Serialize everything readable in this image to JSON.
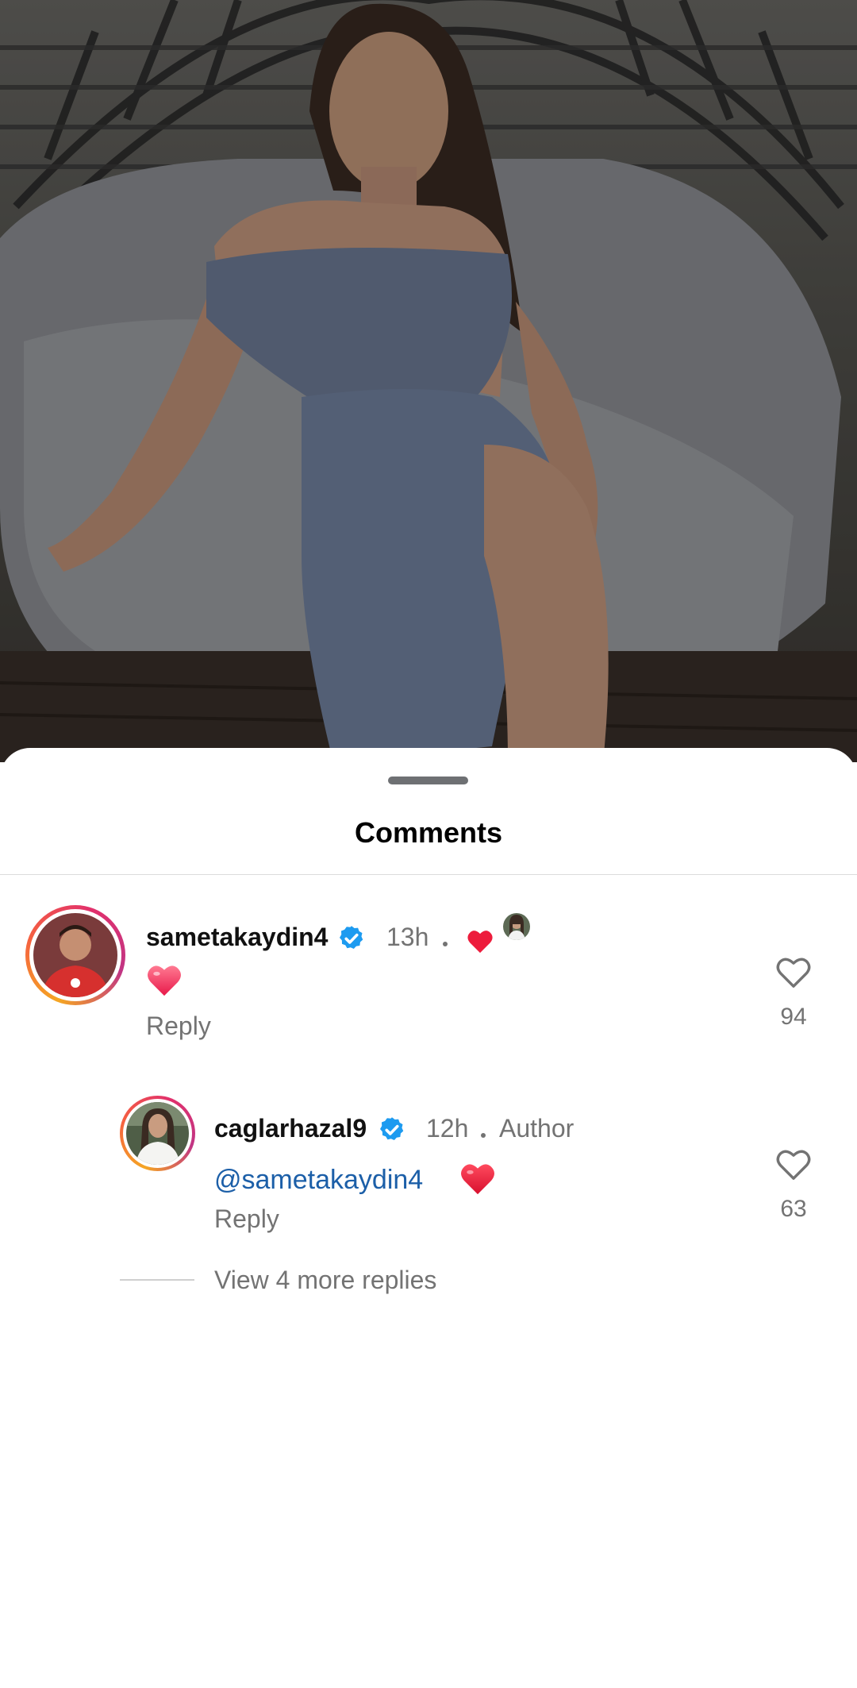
{
  "sheet": {
    "title": "Comments"
  },
  "comments": [
    {
      "username": "sametakaydin4",
      "verified": true,
      "time": "13h",
      "liked_by_author": true,
      "body_emoji": "heart",
      "reply_label": "Reply",
      "likes": "94"
    }
  ],
  "reply": {
    "username": "caglarhazal9",
    "verified": true,
    "time": "12h",
    "badge": "Author",
    "mention": "@sametakaydin4",
    "body_emoji": "heart",
    "reply_label": "Reply",
    "likes": "63"
  },
  "view_more": "View 4 more replies",
  "colors": {
    "verified_blue": "#1d9bf0",
    "heart_red": "#ed1c3c",
    "mention_blue": "#1c5fa8",
    "muted_text": "#737373"
  }
}
